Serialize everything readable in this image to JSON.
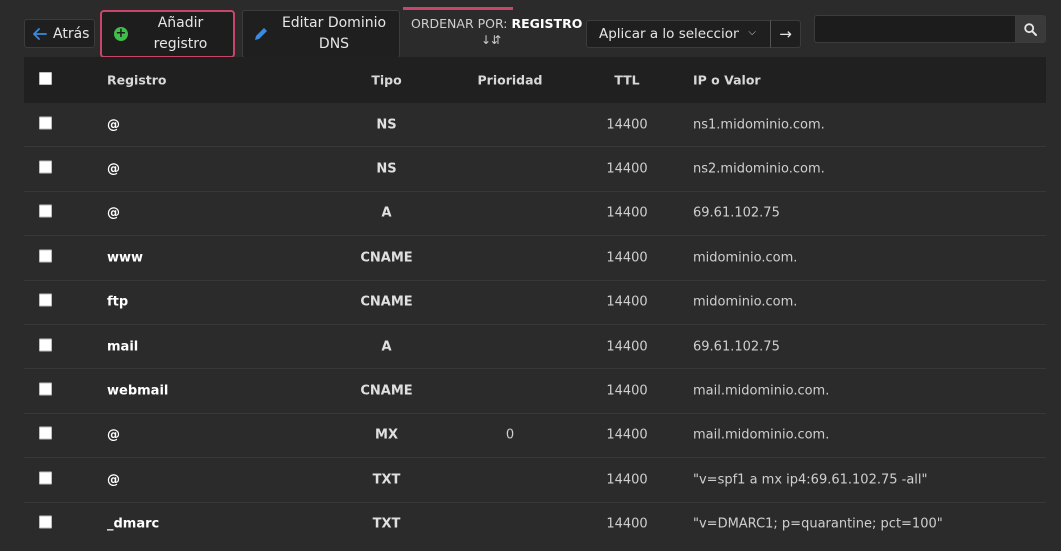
{
  "toolbar": {
    "back_label": "Atrás",
    "add_label_line1": "Añadir",
    "add_label_line2": "registro",
    "edit_label_line1": "Editar Dominio",
    "edit_label_line2": "DNS",
    "sort_prefix": "ORDENAR POR:",
    "sort_value": "REGISTRO",
    "bulk_action_selected": "Aplicar a lo seleccionado",
    "search_placeholder": ""
  },
  "colors": {
    "accent": "#c9456b",
    "add_icon": "#3fbf4a",
    "edit_icon": "#3a8be0",
    "back_icon": "#3a8be0"
  },
  "icons": {
    "back": "arrow-left-icon",
    "add": "plus-circle-icon",
    "edit": "pencil-icon",
    "sort": "sort-alpha-icon",
    "dropdown": "chevron-down-icon",
    "go": "arrow-right-icon",
    "search": "search-icon"
  },
  "table": {
    "headers": {
      "registro": "Registro",
      "tipo": "Tipo",
      "prioridad": "Prioridad",
      "ttl": "TTL",
      "valor": "IP o Valor"
    },
    "rows": [
      {
        "registro": "@",
        "tipo": "NS",
        "prioridad": "",
        "ttl": "14400",
        "valor": "ns1.midominio.com."
      },
      {
        "registro": "@",
        "tipo": "NS",
        "prioridad": "",
        "ttl": "14400",
        "valor": "ns2.midominio.com."
      },
      {
        "registro": "@",
        "tipo": "A",
        "prioridad": "",
        "ttl": "14400",
        "valor": "69.61.102.75"
      },
      {
        "registro": "www",
        "tipo": "CNAME",
        "prioridad": "",
        "ttl": "14400",
        "valor": "midominio.com."
      },
      {
        "registro": "ftp",
        "tipo": "CNAME",
        "prioridad": "",
        "ttl": "14400",
        "valor": "midominio.com."
      },
      {
        "registro": "mail",
        "tipo": "A",
        "prioridad": "",
        "ttl": "14400",
        "valor": "69.61.102.75"
      },
      {
        "registro": "webmail",
        "tipo": "CNAME",
        "prioridad": "",
        "ttl": "14400",
        "valor": "mail.midominio.com."
      },
      {
        "registro": "@",
        "tipo": "MX",
        "prioridad": "0",
        "ttl": "14400",
        "valor": "mail.midominio.com."
      },
      {
        "registro": "@",
        "tipo": "TXT",
        "prioridad": "",
        "ttl": "14400",
        "valor": "\"v=spf1 a mx ip4:69.61.102.75 -all\""
      },
      {
        "registro": "_dmarc",
        "tipo": "TXT",
        "prioridad": "",
        "ttl": "14400",
        "valor": "\"v=DMARC1; p=quarantine; pct=100\""
      }
    ]
  }
}
